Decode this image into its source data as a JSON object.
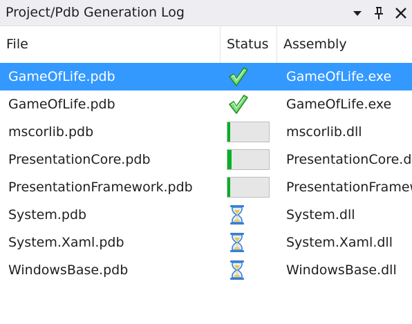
{
  "window": {
    "title": "Project/Pdb Generation Log",
    "buttons": {
      "dropdown": "chevron-down-icon",
      "pin": "pin-icon",
      "close": "close-icon"
    }
  },
  "columns": {
    "file": "File",
    "status": "Status",
    "assembly": "Assembly"
  },
  "colors": {
    "selection": "#3399ff",
    "progress_fill": "#06b025",
    "check": "#2db82d"
  },
  "rows": [
    {
      "file": "GameOfLife.pdb",
      "status": "complete",
      "status_icon": "checkmark-icon",
      "assembly": "GameOfLife.exe",
      "selected": true
    },
    {
      "file": "GameOfLife.pdb",
      "status": "complete",
      "status_icon": "checkmark-icon",
      "assembly": "GameOfLife.exe",
      "selected": false
    },
    {
      "file": "mscorlib.pdb",
      "status": "in-progress",
      "progress": 0.03,
      "assembly": "mscorlib.dll",
      "selected": false
    },
    {
      "file": "PresentationCore.pdb",
      "status": "in-progress",
      "progress": 0.1,
      "assembly": "PresentationCore.dll",
      "selected": false
    },
    {
      "file": "PresentationFramework.pdb",
      "status": "in-progress",
      "progress": 0.06,
      "assembly": "PresentationFramework.dll",
      "selected": false
    },
    {
      "file": "System.pdb",
      "status": "pending",
      "status_icon": "hourglass-icon",
      "assembly": "System.dll",
      "selected": false
    },
    {
      "file": "System.Xaml.pdb",
      "status": "pending",
      "status_icon": "hourglass-icon",
      "assembly": "System.Xaml.dll",
      "selected": false
    },
    {
      "file": "WindowsBase.pdb",
      "status": "pending",
      "status_icon": "hourglass-icon",
      "assembly": "WindowsBase.dll",
      "selected": false
    }
  ]
}
